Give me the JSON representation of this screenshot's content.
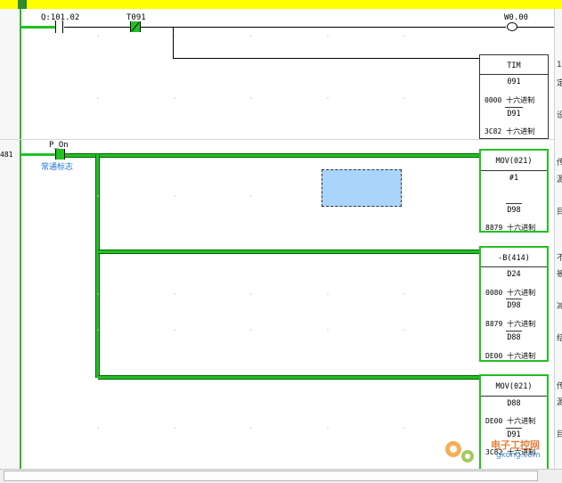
{
  "toolbar": {},
  "gutter": {
    "rung_number": "481"
  },
  "rung1": {
    "contact1_addr": "Q:101.02",
    "contact2_addr": "T091",
    "coil_addr": "W0.00",
    "timer": {
      "title": "TIM",
      "number": "091",
      "sv_value": "0000",
      "sv_radix": "十六进制",
      "sv_operand": "D91",
      "pv_value": "3C82",
      "pv_radix": "十六进制"
    },
    "side": [
      "1",
      "定",
      "设"
    ]
  },
  "rung2": {
    "contact_addr": "P_On",
    "contact_comment": "常通标志",
    "mov1": {
      "title": "MOV(021)",
      "src": "#1",
      "dst": "D98",
      "dst_value": "8879",
      "dst_radix": "十六进制"
    },
    "sub": {
      "title": "-B(414)",
      "op1": "D24",
      "op1_value": "0080",
      "op1_radix": "十六进制",
      "op2": "D98",
      "op2_value": "8879",
      "op2_radix": "十六进制",
      "dst": "D88",
      "dst_value": "DE00",
      "dst_radix": "十六进制"
    },
    "mov2": {
      "title": "MOV(021)",
      "src": "D88",
      "src_value": "DE00",
      "src_radix": "十六进制",
      "dst": "D91",
      "dst_value": "3C82",
      "dst_radix": "十六进制"
    },
    "side": [
      "传",
      "源",
      "目",
      "不",
      "被",
      "减",
      "结",
      "传",
      "源",
      "目"
    ]
  },
  "watermark": {
    "brand": "电子工控网",
    "url": "gkong.com"
  },
  "colors": {
    "rail": "#2cb52c",
    "powered": "#22c022",
    "highlight": "#ffff00",
    "selection": "#aad4fb",
    "comment": "#1f6fd0"
  }
}
